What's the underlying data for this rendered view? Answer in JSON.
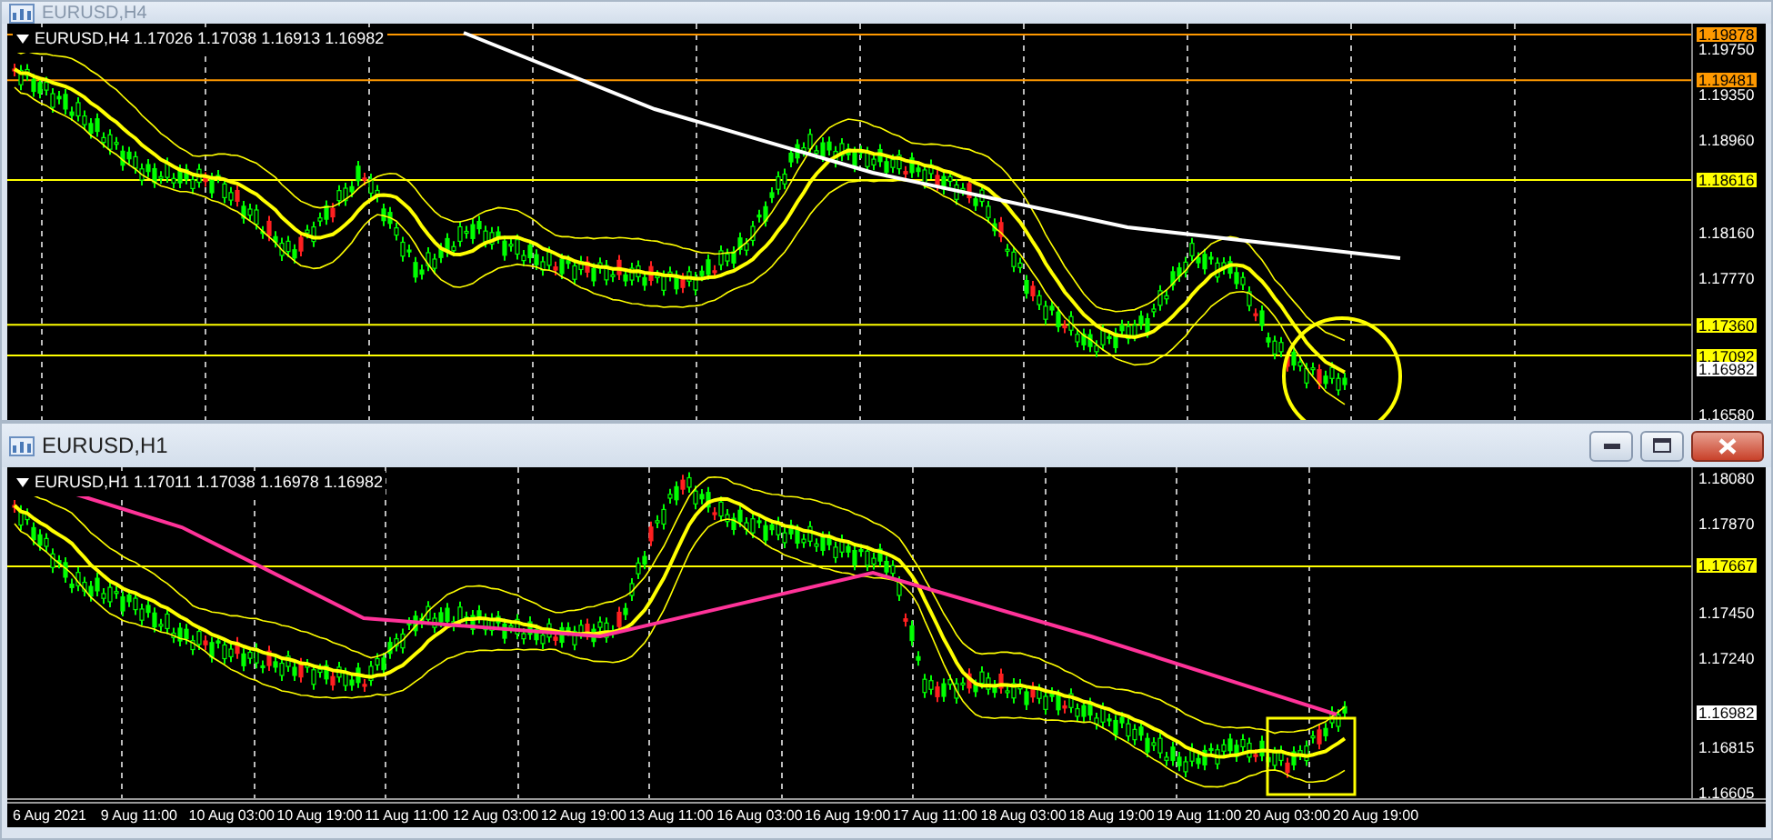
{
  "windows": [
    {
      "title": "EURUSD,H4",
      "info": "EURUSD,H4  1.17026 1.17038 1.16913 1.16982",
      "window_buttons": false,
      "axis_labels": [
        "1.19750",
        "1.19350",
        "1.18960",
        "1.18160",
        "1.17770",
        "1.16580"
      ],
      "levels": [
        {
          "label": "1.19878",
          "color": "#ff9900"
        },
        {
          "label": "1.19481",
          "color": "#ff9900"
        },
        {
          "label": "1.18616",
          "color": "#ffff00"
        },
        {
          "label": "1.17360",
          "color": "#ffff00"
        },
        {
          "label": "1.17092",
          "color": "#ffff00"
        }
      ],
      "current_price": "1.16982"
    },
    {
      "title": "EURUSD,H1",
      "info": "EURUSD,H1  1.17011 1.17038 1.16978 1.16982",
      "window_buttons": true,
      "axis_labels": [
        "1.18080",
        "1.17870",
        "1.17450",
        "1.17240",
        "1.16815",
        "1.16605"
      ],
      "levels": [
        {
          "label": "1.17667",
          "color": "#ffff00"
        }
      ],
      "current_price": "1.16982",
      "time_labels": [
        "6 Aug 2021",
        "9 Aug 11:00",
        "10 Aug 03:00",
        "10 Aug 19:00",
        "11 Aug 11:00",
        "12 Aug 03:00",
        "12 Aug 19:00",
        "13 Aug 11:00",
        "16 Aug 03:00",
        "16 Aug 19:00",
        "17 Aug 11:00",
        "18 Aug 03:00",
        "18 Aug 19:00",
        "19 Aug 11:00",
        "20 Aug 03:00",
        "20 Aug 19:00"
      ]
    }
  ]
}
